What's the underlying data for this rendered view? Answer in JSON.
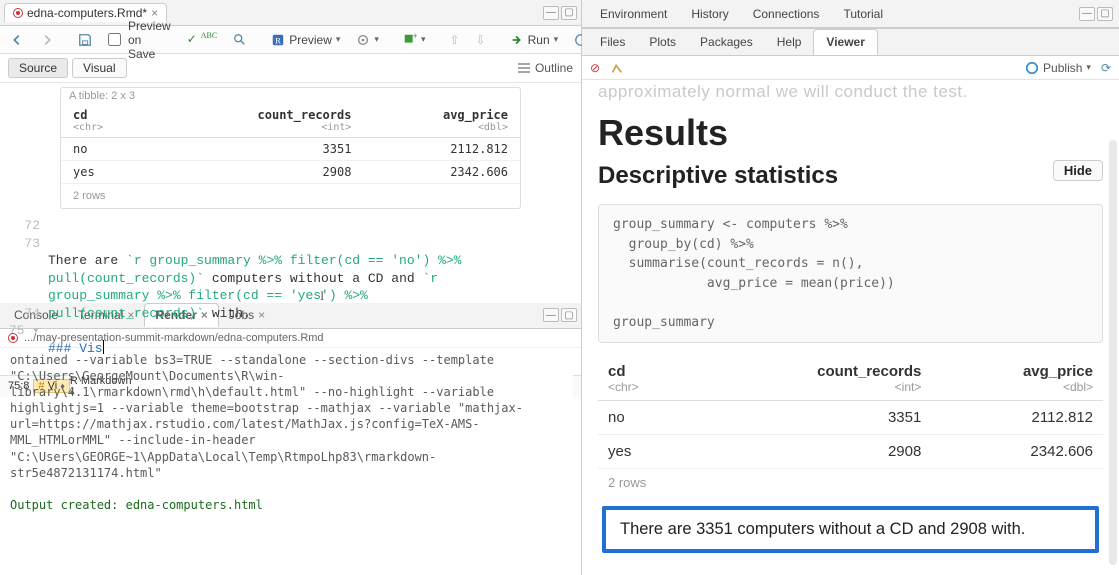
{
  "file_tab": {
    "name": "edna-computers.Rmd*",
    "dirty": true
  },
  "toolbar": {
    "preview_on_save": "Preview on Save",
    "preview": "Preview",
    "run": "Run"
  },
  "srcvis": {
    "source": "Source",
    "visual": "Visual",
    "outline": "Outline"
  },
  "tibble": {
    "header_note": "A tibble: 2 x 3",
    "cols": [
      {
        "name": "cd",
        "type": "<chr>"
      },
      {
        "name": "count_records",
        "type": "<int>"
      },
      {
        "name": "avg_price",
        "type": "<dbl>"
      }
    ],
    "rows": [
      {
        "cd": "no",
        "count_records": 3351,
        "avg_price": "2112.812"
      },
      {
        "cd": "yes",
        "count_records": 2908,
        "avg_price": "2342.606"
      }
    ],
    "footer": "2 rows"
  },
  "editor": {
    "lines": {
      "72": "",
      "73a": "There are `r group_summary %>% filter(cd == 'no') %>%",
      "73b": "pull(count_records)` computers without a CD and `r",
      "73c": "group_summary %>% filter(cd == 'yes') %>%",
      "73d": "pull(count_records)` with.",
      "74": "",
      "75": "### Vis"
    }
  },
  "statusbar": {
    "pos": "75:8",
    "chunk": "Vi",
    "lang": "R Markdown"
  },
  "console_tabs": {
    "console": "Console",
    "terminal": "Terminal",
    "render": "Render",
    "jobs": "Jobs"
  },
  "console_path": ".../may-presentation-summit-markdown/edna-computers.Rmd",
  "console_body_grey": "ontained --variable bs3=TRUE --standalone --section-divs --template \"C:\\Users\\GeorgeMount\\Documents\\R\\win-library\\4.1\\rmarkdown\\rmd\\h\\default.html\" --no-highlight --variable highlightjs=1 --variable theme=bootstrap --mathjax --variable \"mathjax-url=https://mathjax.rstudio.com/latest/MathJax.js?config=TeX-AMS-MML_HTMLorMML\" --include-in-header \"C:\\Users\\GEORGE~1\\AppData\\Local\\Temp\\RtmpoLhp83\\rmarkdown-str5e4872131174.html\"",
  "console_body_green": "Output created: edna-computers.html",
  "right_tabs_top": {
    "environment": "Environment",
    "history": "History",
    "connections": "Connections",
    "tutorial": "Tutorial"
  },
  "right_tabs_bottom": {
    "files": "Files",
    "plots": "Plots",
    "packages": "Packages",
    "help": "Help",
    "viewer": "Viewer"
  },
  "publish": "Publish",
  "viewer": {
    "faded": "approximately normal we will conduct the test.",
    "h1": "Results",
    "h2": "Descriptive statistics",
    "hide": "Hide",
    "code": "group_summary <- computers %>%\n  group_by(cd) %>%\n  summarise(count_records = n(),\n            avg_price = mean(price))\n\ngroup_summary",
    "sentence": "There are 3351 computers without a CD and 2908 with."
  },
  "chart_data": {
    "type": "table",
    "title": "group_summary",
    "columns": [
      "cd",
      "count_records",
      "avg_price"
    ],
    "column_types": [
      "<chr>",
      "<int>",
      "<dbl>"
    ],
    "rows": [
      [
        "no",
        3351,
        2112.812
      ],
      [
        "yes",
        2908,
        2342.606
      ]
    ],
    "nrow_note": "2 rows"
  }
}
